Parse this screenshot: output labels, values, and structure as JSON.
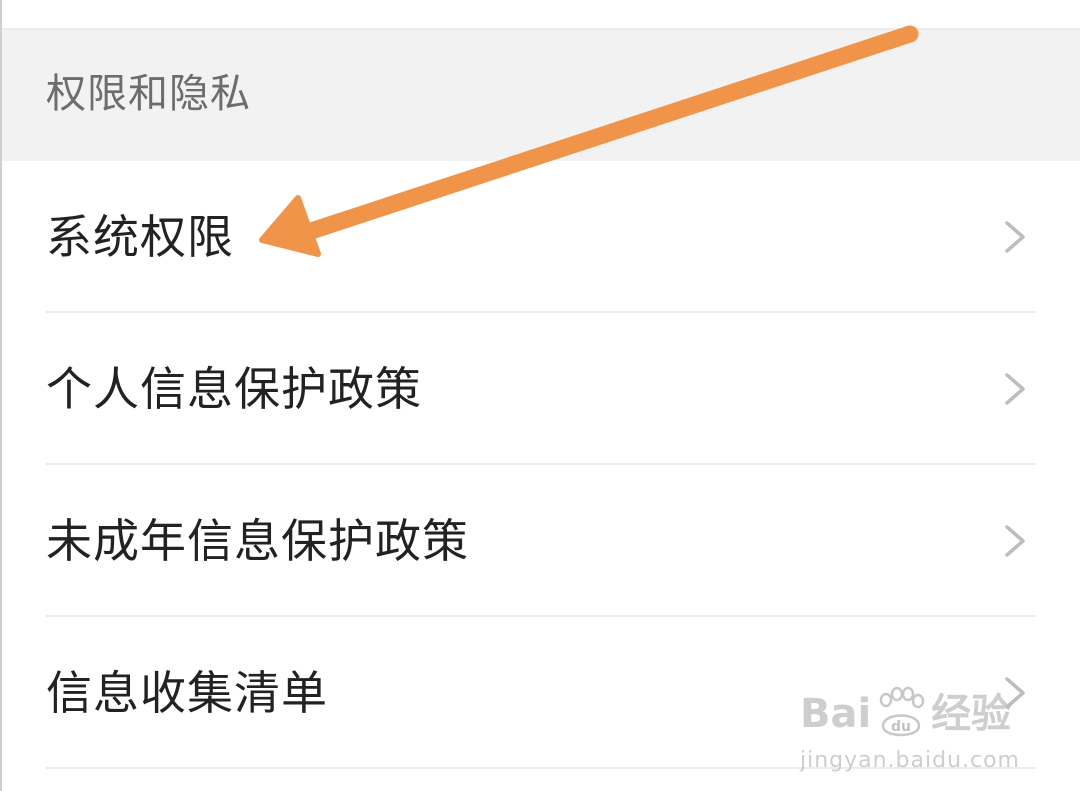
{
  "section": {
    "title": "权限和隐私"
  },
  "items": [
    {
      "label": "系统权限",
      "icon": "chevron-right-icon"
    },
    {
      "label": "个人信息保护政策",
      "icon": "chevron-right-icon"
    },
    {
      "label": "未成年信息保护政策",
      "icon": "chevron-right-icon"
    },
    {
      "label": "信息收集清单",
      "icon": "chevron-right-icon"
    }
  ],
  "annotation": {
    "arrow_color": "#f0944a",
    "points_to": "系统权限"
  },
  "watermark": {
    "logo_left": "Bai",
    "logo_right": "经验",
    "url": "jingyan.baidu.com",
    "paw_text": "du"
  },
  "colors": {
    "header_bg": "#f2f2f2",
    "divider": "#ececec",
    "text_primary": "#222222",
    "text_secondary": "#6d6d6d",
    "chevron": "#bdbdbd"
  }
}
